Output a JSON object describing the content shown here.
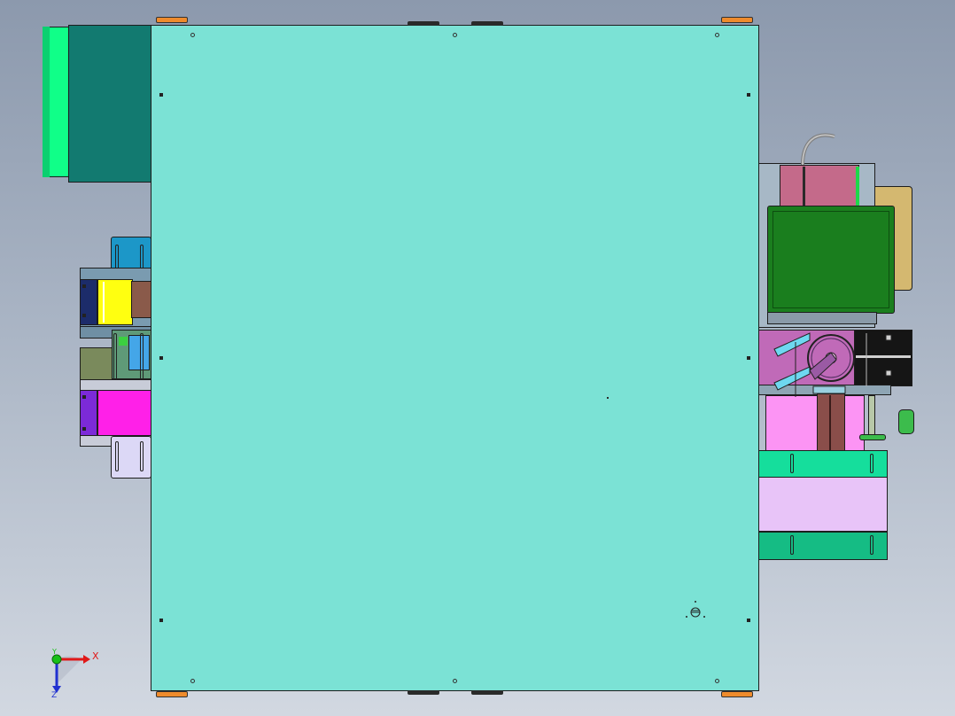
{
  "viewport": {
    "background_top": "#8c99ad",
    "background_bottom": "#d2d8e1"
  },
  "model": {
    "main_plate_color": "#7be2d5",
    "edge_color": "#1d1d1d",
    "left_housing_color": "#127a70",
    "left_cap_color": "#10ff88",
    "motor_body_color": "#1a7e1e",
    "motor_cap_color": "#c46a8a",
    "tan_bracket_color": "#d4b870",
    "violet_block_color": "#c06ab8",
    "black_block_color": "#151515",
    "mint_plate_color": "#15de9c",
    "lavender_block_color": "#e8c4f8",
    "pink_block_color": "#fc94f4",
    "brown_rail_color": "#8a4e4a",
    "yellow_block_color": "#ffff10",
    "magenta_block_color": "#ff20e8",
    "navy_block_color": "#1c2c6a",
    "purple_block_color": "#7c2ad8",
    "orange_tab_color": "#ef8b2c"
  },
  "triad": {
    "x_label": "X",
    "y_label": "Y",
    "z_label": "Z",
    "x_color": "#e01818",
    "y_color": "#18c018",
    "z_color": "#2030d0"
  }
}
